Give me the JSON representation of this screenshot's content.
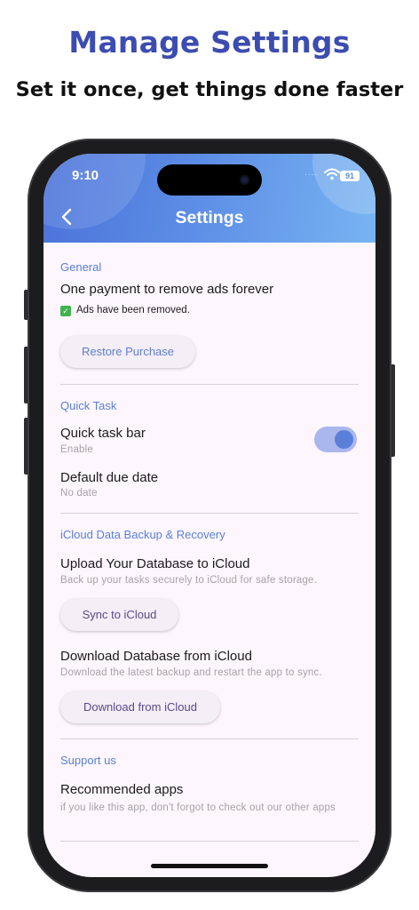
{
  "promo": {
    "headline": "Manage Settings",
    "subline": "Set it once, get things done faster"
  },
  "status_bar": {
    "time": "9:10",
    "signal": "....",
    "battery": "91"
  },
  "header": {
    "title": "Settings",
    "back_icon": "chevron-left-icon"
  },
  "sections": {
    "general": {
      "title": "General",
      "item_title": "One payment to remove ads forever",
      "status_text": "Ads have been removed.",
      "check": "✓",
      "restore_label": "Restore Purchase"
    },
    "quick_task": {
      "title": "Quick Task",
      "bar_title": "Quick task bar",
      "bar_sub": "Enable",
      "bar_enabled": true,
      "due_title": "Default due date",
      "due_sub": "No date"
    },
    "icloud": {
      "title": "iCloud Data Backup & Recovery",
      "upload_title": "Upload Your Database to iCloud",
      "upload_sub": "Back up your tasks securely to iCloud for safe storage.",
      "sync_label": "Sync to iCloud",
      "download_title": "Download Database from iCloud",
      "download_sub": "Download the latest backup and restart the app to sync.",
      "download_label": "Download from iCloud"
    },
    "support": {
      "title": "Support us",
      "rec_title": "Recommended apps",
      "rec_sub": "if you like this app, don't forgot to check out our other apps"
    }
  },
  "colors": {
    "accent": "#5a7fd8",
    "headline": "#3c4cb0",
    "header_start": "#4b72d9",
    "header_end": "#78b4f2",
    "screen_bg": "#fdf6fd"
  }
}
